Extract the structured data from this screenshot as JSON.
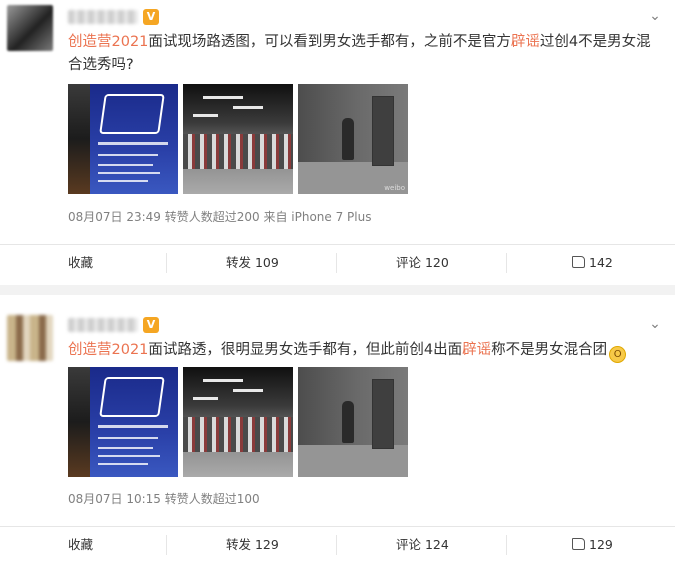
{
  "posts": [
    {
      "vip_badge": "V",
      "text": {
        "topic": "创造营2021",
        "part1": "面试现场路透图，可以看到男女选手都有，之前不是官方",
        "highlight": "辟谣",
        "part2": "过创4不是男女混合选秀吗?"
      },
      "meta": "08月07日 23:49 转赞人数超过200  来自 iPhone 7 Plus",
      "actions": {
        "favorite": "收藏",
        "repost": "转发 109",
        "comment": "评论 120",
        "like_count": "142"
      }
    },
    {
      "vip_badge": "V",
      "text": {
        "topic": "创造营2021",
        "part1": "面试路透，很明显男女选手都有，但此前创4出面",
        "highlight": "辟谣",
        "part2": "称不是男女混合团"
      },
      "emoji": "astonished-face",
      "meta": "08月07日 10:15 转赞人数超过100",
      "actions": {
        "favorite": "收藏",
        "repost": "转发 129",
        "comment": "评论 124",
        "like_count": "129"
      }
    }
  ],
  "colors": {
    "topic": "#eb7350",
    "text": "#333333",
    "meta": "#808080",
    "vip": "#f5a623",
    "page_bg": "#f2f2f2"
  },
  "icons": [
    "chevron-down-icon",
    "vip-badge-icon",
    "thumbs-up-icon",
    "astonished-emoji-icon"
  ]
}
